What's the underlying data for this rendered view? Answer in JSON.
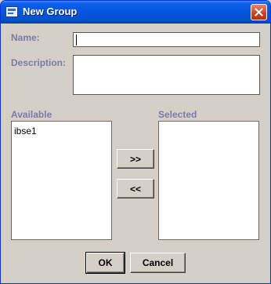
{
  "window": {
    "title": "New Group",
    "close_label": "close"
  },
  "form": {
    "name_label": "Name:",
    "name_value": "",
    "description_label": "Description:",
    "description_value": ""
  },
  "available": {
    "label": "Available",
    "items": [
      "ibse1"
    ]
  },
  "selected": {
    "label": "Selected",
    "items": []
  },
  "transfer": {
    "add_label": ">>",
    "remove_label": "<<"
  },
  "actions": {
    "ok_label": "OK",
    "cancel_label": "Cancel"
  }
}
